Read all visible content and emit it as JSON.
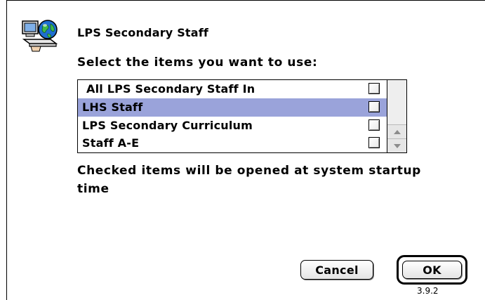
{
  "dialog": {
    "title": "LPS Secondary Staff",
    "prompt": "Select the items you want to use:",
    "items": [
      {
        "label": "All LPS Secondary Staff In",
        "checked": false,
        "selected": false
      },
      {
        "label": "LHS Staff",
        "checked": false,
        "selected": true
      },
      {
        "label": "LPS Secondary Curriculum",
        "checked": false,
        "selected": false
      },
      {
        "label": "Staff A-E",
        "checked": false,
        "selected": false
      }
    ],
    "note": "Checked items will be opened at system startup time",
    "cancel_label": "Cancel",
    "ok_label": "OK",
    "version": "3.9.2"
  },
  "icons": {
    "app": "network-globe-tray-icon",
    "scroll_up": "scroll-up-arrow-icon",
    "scroll_down": "scroll-down-arrow-icon"
  },
  "colors": {
    "selection": "#9aa3da",
    "background": "#ffffff",
    "globe": "#1e6fd0"
  }
}
